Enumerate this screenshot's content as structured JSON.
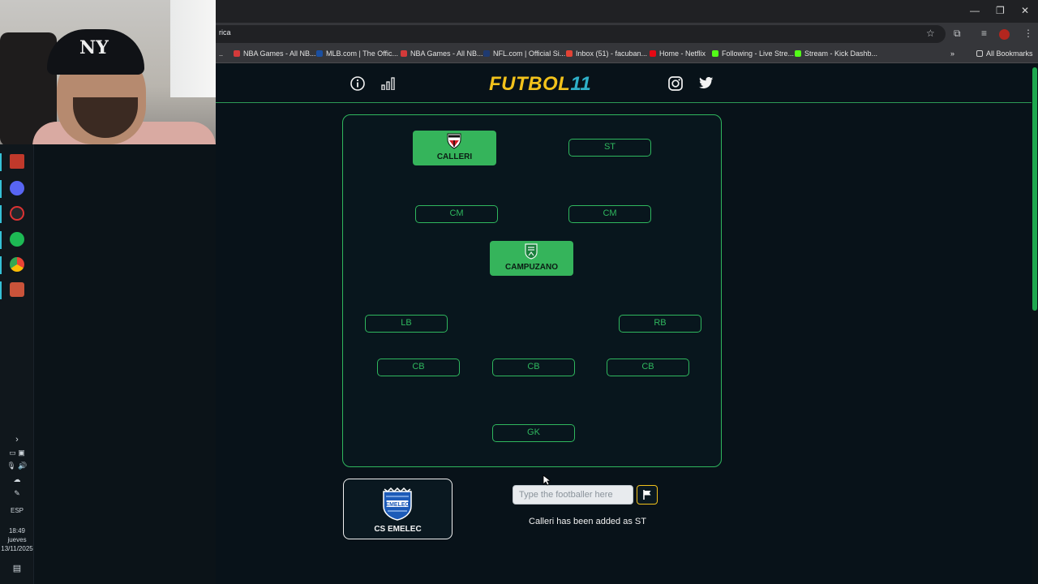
{
  "browser": {
    "address_text": "rica",
    "bookmarks": [
      {
        "label": "NBA Games - All NB...",
        "color": "#d43a3a"
      },
      {
        "label": "MLB.com | The Offic...",
        "color": "#1b4fa0"
      },
      {
        "label": "NBA Games - All NB...",
        "color": "#d43a3a"
      },
      {
        "label": "NFL.com | Official Si...",
        "color": "#1f3a70"
      },
      {
        "label": "Inbox (51) - facuban...",
        "color": "#e24335"
      },
      {
        "label": "Home - Netflix",
        "color": "#e50914"
      },
      {
        "label": "Following - Live Stre...",
        "color": "#53fc18"
      },
      {
        "label": "Stream - Kick Dashb...",
        "color": "#53fc18"
      }
    ],
    "all_bookmarks": "All Bookmarks"
  },
  "taskbar": {
    "language": "ESP",
    "time": "18:49",
    "day": "jueves",
    "date": "13/11/2025"
  },
  "site": {
    "logo_part1": "FUTBOL",
    "logo_part2": "11",
    "info_icon": "info-icon",
    "stats_icon": "bar-chart-icon",
    "instagram_icon": "instagram-icon",
    "twitter_icon": "twitter-icon"
  },
  "pitch": {
    "players": {
      "lw": {
        "name": "CALLERI",
        "club_crest": "spfc-crest-icon"
      },
      "cam": {
        "name": "CAMPUZANO",
        "club_crest": "atletico-nacional-crest-icon"
      }
    },
    "slots": {
      "st": "ST",
      "cm_left": "CM",
      "cm_right": "CM",
      "lb": "LB",
      "rb": "RB",
      "cb_left": "CB",
      "cb_mid": "CB",
      "cb_right": "CB",
      "gk": "GK"
    }
  },
  "club_card": {
    "name": "CS EMELEC",
    "crest": "emelec-crest-icon"
  },
  "search": {
    "placeholder": "Type the footballer here",
    "value": ""
  },
  "status_message": "Calleri has been added as ST",
  "colors": {
    "accent_green": "#2fb75e",
    "logo_yellow": "#f2c21b",
    "logo_cyan": "#2fb0c8",
    "background": "#081219"
  }
}
